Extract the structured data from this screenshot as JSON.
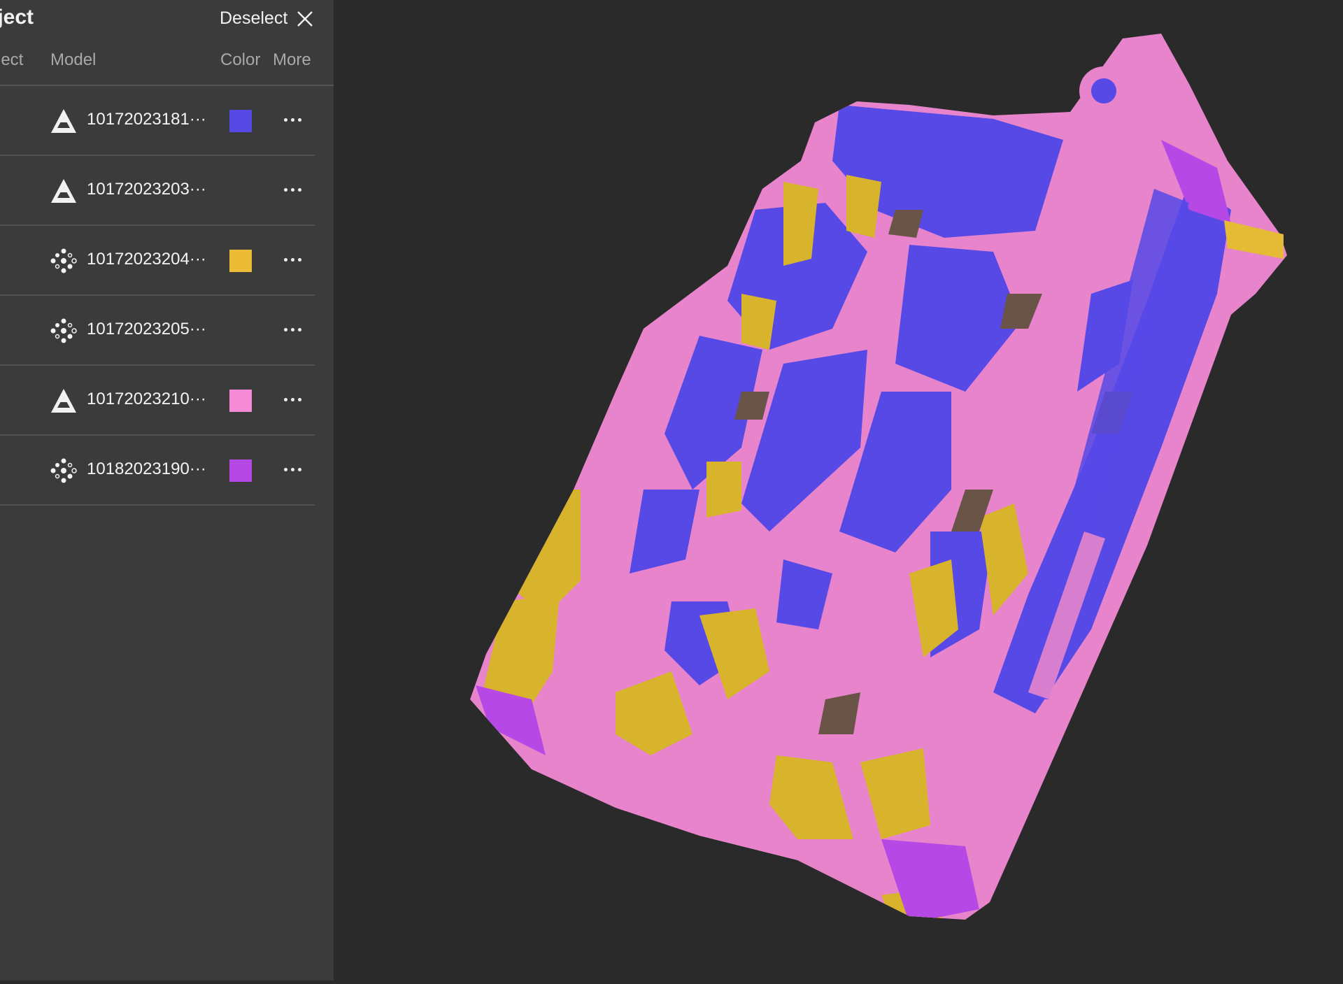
{
  "panel": {
    "title": "oject",
    "deselect_label": "Deselect",
    "columns": {
      "select": "lect",
      "model": "Model",
      "color": "Color",
      "more": "More"
    },
    "models": [
      {
        "name": "10172023181···",
        "icon": "mesh-icon",
        "color": "#5649e6"
      },
      {
        "name": "10172023203···",
        "icon": "mesh-icon",
        "color": null
      },
      {
        "name": "10172023204···",
        "icon": "point-cloud-icon",
        "color": "#ebbb35"
      },
      {
        "name": "10172023205···",
        "icon": "point-cloud-icon",
        "color": null
      },
      {
        "name": "10172023210···",
        "icon": "mesh-icon",
        "color": "#f58ad6"
      },
      {
        "name": "10182023190···",
        "icon": "point-cloud-icon",
        "color": "#b649e6"
      }
    ]
  },
  "viewport": {
    "colors": {
      "blue": "#5649e6",
      "yellow": "#d8b32c",
      "pink": "#f08bd4",
      "purple": "#b649e6",
      "shadow": "#6a5448",
      "background": "#2a2a2a"
    }
  }
}
